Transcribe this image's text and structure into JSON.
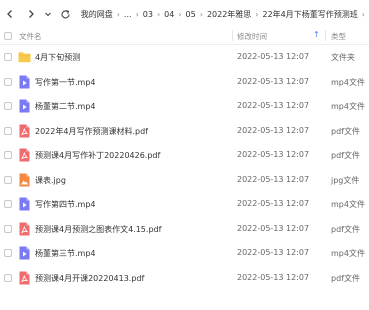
{
  "breadcrumb": {
    "items": [
      "我的网盘",
      "...",
      "03",
      "04",
      "05",
      "2022年雅思",
      "22年4月下杨董写作预测班"
    ]
  },
  "columns": {
    "name": "文件名",
    "date": "修改时间",
    "type": "类型",
    "sort_indicator": "↑"
  },
  "colors": {
    "folder": "#F9C94E",
    "video": "#7B79F7",
    "pdf": "#F06B6B",
    "image": "#F5883E",
    "sort_accent": "#4A7FF0"
  },
  "files": [
    {
      "name": "4月下旬预测",
      "date": "2022-05-13 12:07",
      "type": "文件夹",
      "icon": "folder-icon"
    },
    {
      "name": "写作第一节.mp4",
      "date": "2022-05-13 12:07",
      "type": "mp4文件",
      "icon": "video-file-icon"
    },
    {
      "name": "杨董第二节.mp4",
      "date": "2022-05-13 12:07",
      "type": "mp4文件",
      "icon": "video-file-icon"
    },
    {
      "name": "2022年4月写作预测课材料.pdf",
      "date": "2022-05-13 12:07",
      "type": "pdf文件",
      "icon": "pdf-file-icon"
    },
    {
      "name": "预测课4月写作补丁20220426.pdf",
      "date": "2022-05-13 12:07",
      "type": "pdf文件",
      "icon": "pdf-file-icon"
    },
    {
      "name": "课表.jpg",
      "date": "2022-05-13 12:07",
      "type": "jpg文件",
      "icon": "image-file-icon"
    },
    {
      "name": "写作第四节.mp4",
      "date": "2022-05-13 12:07",
      "type": "mp4文件",
      "icon": "video-file-icon"
    },
    {
      "name": "预测课4月预测之图表作文4.15.pdf",
      "date": "2022-05-13 12:07",
      "type": "pdf文件",
      "icon": "pdf-file-icon"
    },
    {
      "name": "杨董第三节.mp4",
      "date": "2022-05-13 12:07",
      "type": "mp4文件",
      "icon": "video-file-icon"
    },
    {
      "name": "预测课4月开课20220413.pdf",
      "date": "2022-05-13 12:07",
      "type": "pdf文件",
      "icon": "pdf-file-icon"
    }
  ]
}
